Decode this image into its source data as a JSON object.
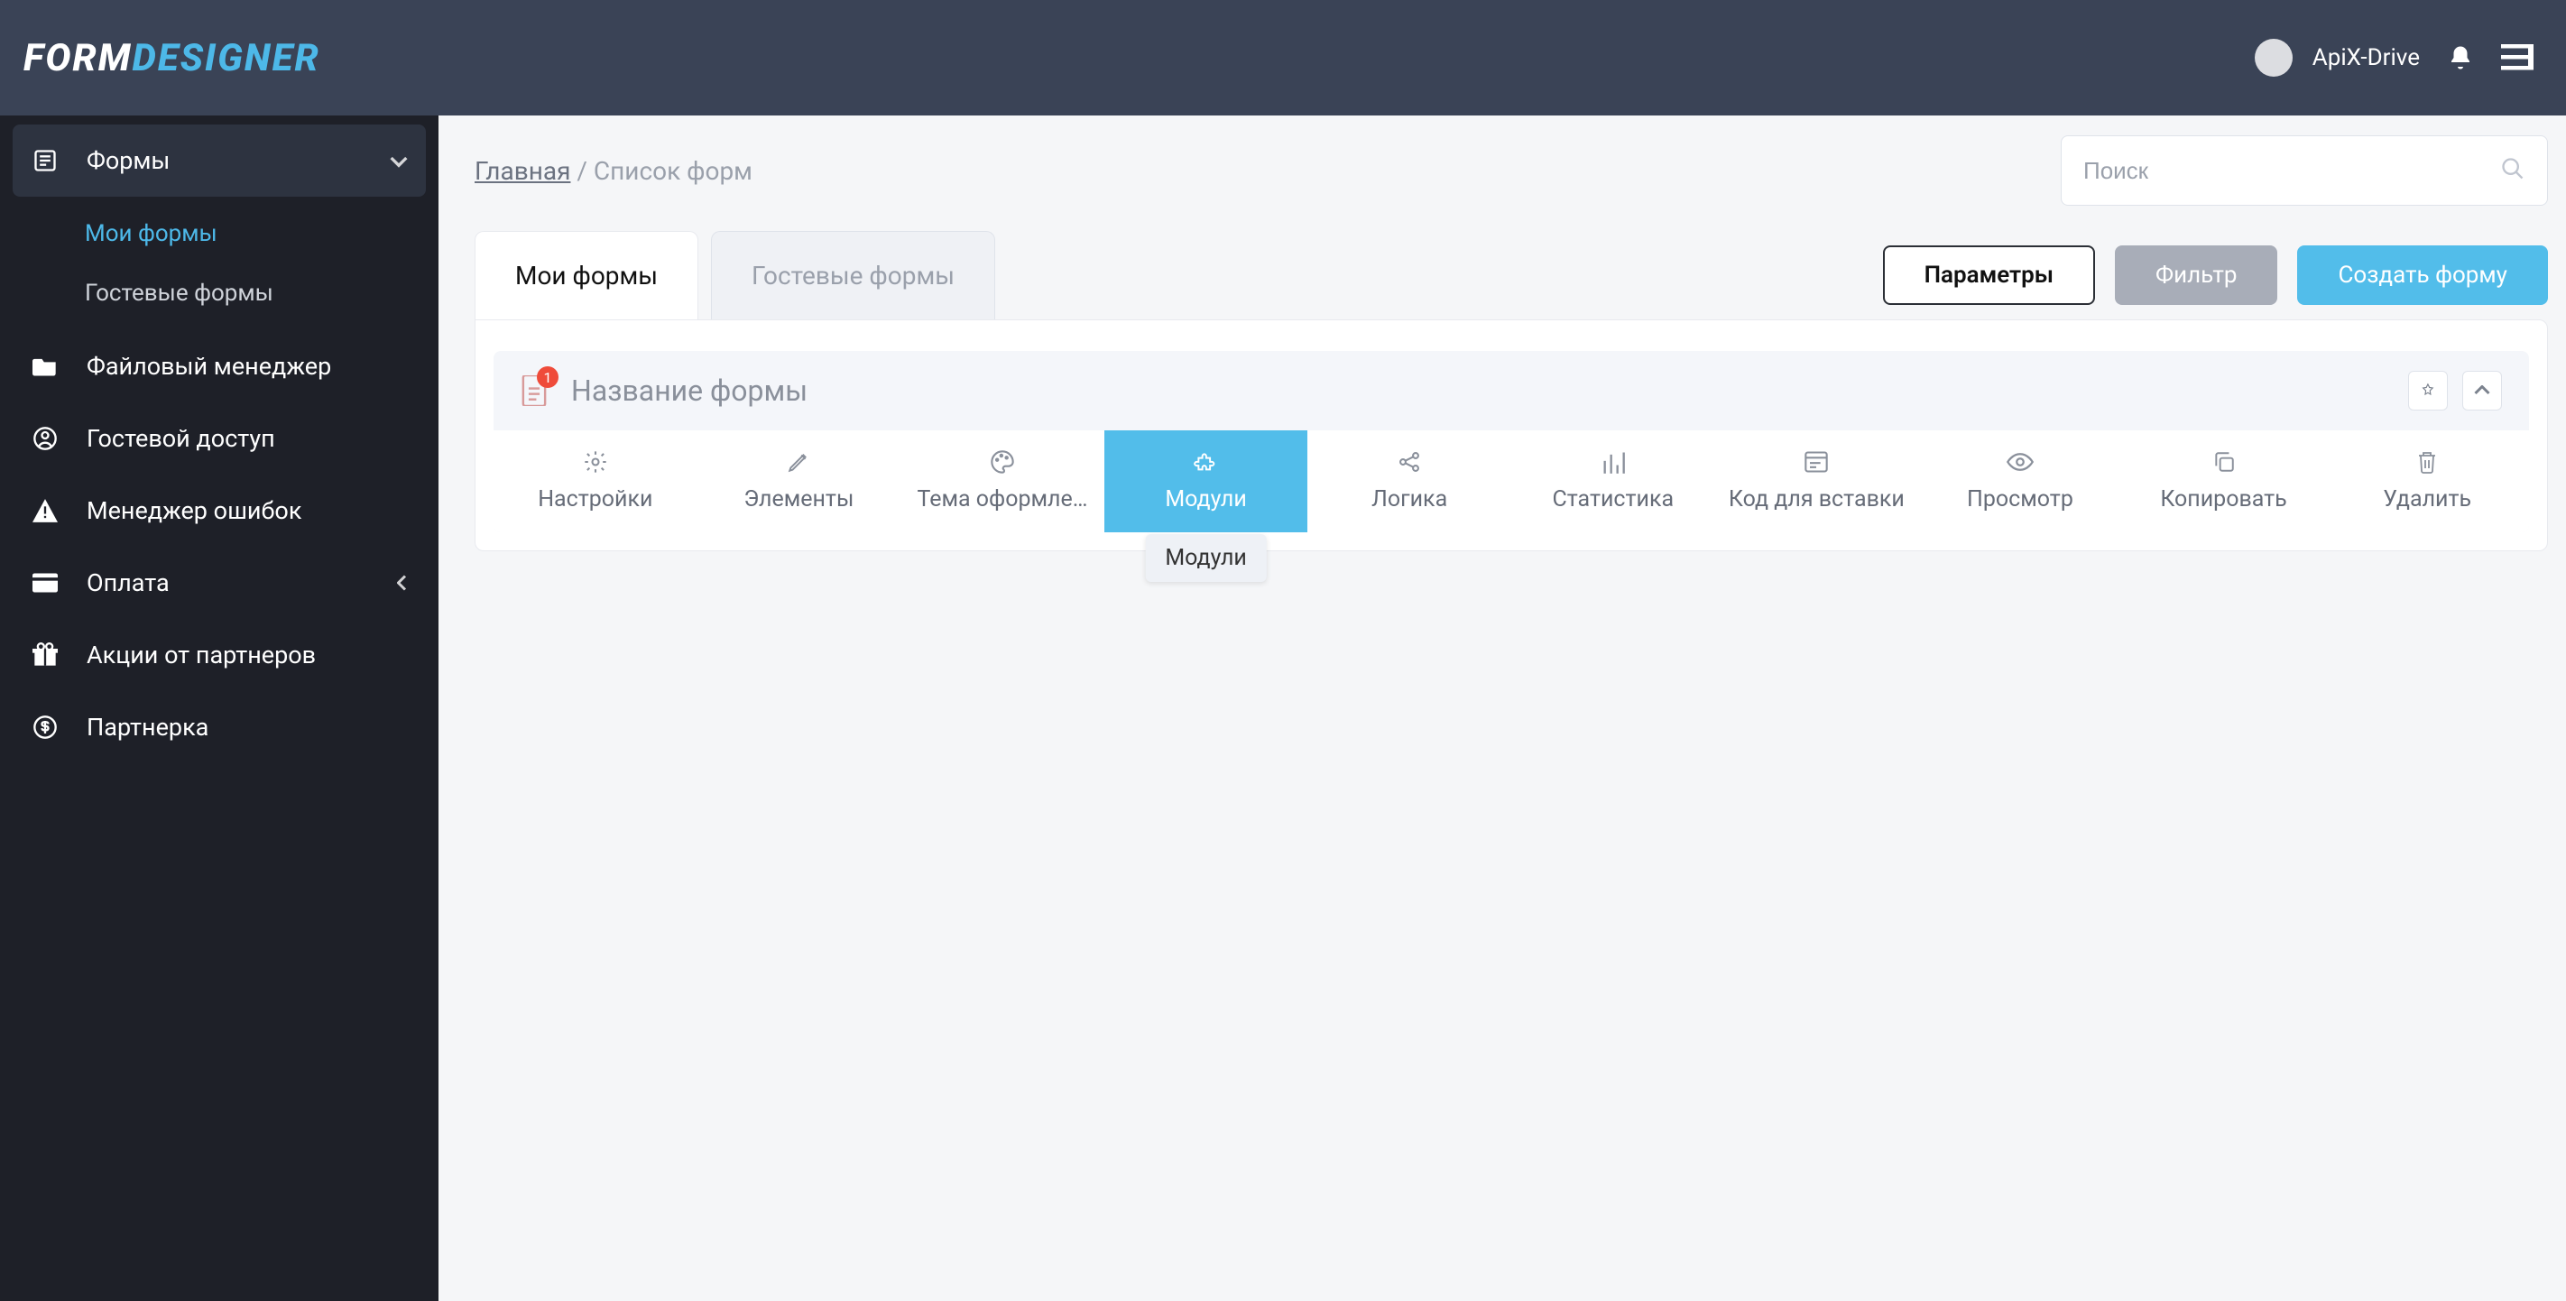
{
  "logo": {
    "part1": "FORM",
    "part2": "DESIGNER"
  },
  "user": {
    "name": "ApiX-Drive"
  },
  "sidebar": {
    "items": [
      {
        "label": "Формы",
        "icon": "form"
      },
      {
        "label": "Файловый менеджер",
        "icon": "folder"
      },
      {
        "label": "Гостевой доступ",
        "icon": "user"
      },
      {
        "label": "Менеджер ошибок",
        "icon": "warning"
      },
      {
        "label": "Оплата",
        "icon": "card"
      },
      {
        "label": "Акции от партнеров",
        "icon": "gift"
      },
      {
        "label": "Партнерка",
        "icon": "dollar"
      }
    ],
    "forms_sub": [
      {
        "label": "Мои формы"
      },
      {
        "label": "Гостевые формы"
      }
    ]
  },
  "breadcrumb": {
    "home": "Главная",
    "sep": "/",
    "current": "Список форм"
  },
  "search": {
    "placeholder": "Поиск"
  },
  "tabs": [
    {
      "label": "Мои формы",
      "active": true
    },
    {
      "label": "Гостевые формы",
      "active": false
    }
  ],
  "buttons": {
    "params": "Параметры",
    "filter": "Фильтр",
    "create": "Создать форму"
  },
  "form_card": {
    "title": "Название формы",
    "badge": "1",
    "tooltip": "Модули",
    "toolbar": [
      {
        "label": "Настройки",
        "icon": "gear"
      },
      {
        "label": "Элементы",
        "icon": "pencil"
      },
      {
        "label": "Тема оформле…",
        "icon": "palette"
      },
      {
        "label": "Модули",
        "icon": "puzzle",
        "active": true
      },
      {
        "label": "Логика",
        "icon": "share"
      },
      {
        "label": "Статистика",
        "icon": "bars"
      },
      {
        "label": "Код для вставки",
        "icon": "snippet"
      },
      {
        "label": "Просмотр",
        "icon": "eye"
      },
      {
        "label": "Копировать",
        "icon": "copy"
      },
      {
        "label": "Удалить",
        "icon": "trash"
      }
    ]
  }
}
